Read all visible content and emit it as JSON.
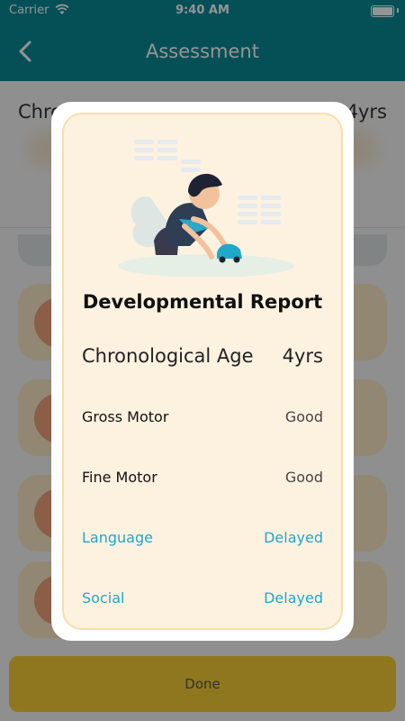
{
  "status_bar": {
    "carrier": "Carrier",
    "time": "9:40 AM"
  },
  "nav": {
    "title": "Assessment"
  },
  "background": {
    "row_left": "Chro",
    "row_right": "4yrs"
  },
  "done_button": {
    "label": "Done"
  },
  "modal": {
    "title": "Developmental Report",
    "age_label": "Chronological Age",
    "age_value": "4yrs",
    "rows": [
      {
        "label": "Gross Motor",
        "value": "Good"
      },
      {
        "label": "Fine Motor",
        "value": "Good"
      },
      {
        "label": "Language",
        "value": "Delayed"
      },
      {
        "label": "Social",
        "value": "Delayed"
      }
    ]
  },
  "colors": {
    "header": "#0a8a96",
    "delayed": "#1fa7cc",
    "modal_bg": "#fdf2e0",
    "done_button": "#f6cd36"
  },
  "icons": [
    "wifi-icon",
    "battery-icon",
    "back-icon",
    "child-playing-illustration"
  ]
}
